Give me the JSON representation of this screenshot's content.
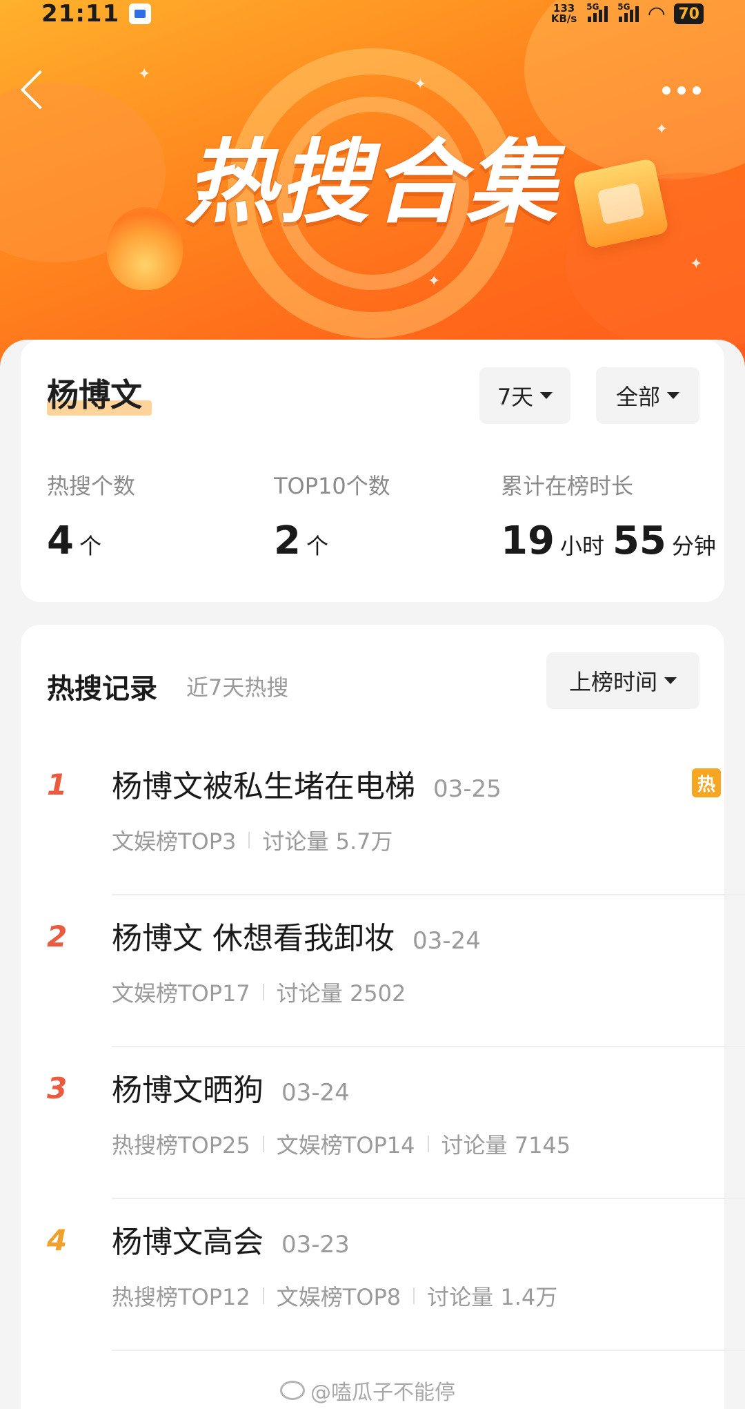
{
  "status_bar": {
    "time": "21:11",
    "speed_value": "133",
    "speed_unit": "KB/s",
    "sim1": "5G",
    "sim2": "5G",
    "battery": "70"
  },
  "header": {
    "title": "热搜合集",
    "back_icon": "chevron-left-icon",
    "more_icon": "more-dots-icon"
  },
  "profile": {
    "name": "杨博文",
    "filter_days": "7天",
    "filter_scope": "全部",
    "stats": [
      {
        "label": "热搜个数",
        "value": "4",
        "unit": "个"
      },
      {
        "label": "TOP10个数",
        "value": "2",
        "unit": "个"
      },
      {
        "label": "累计在榜时长",
        "hours": "19",
        "hours_unit": "小时",
        "minutes": "55",
        "minutes_unit": "分钟"
      }
    ]
  },
  "records": {
    "title": "热搜记录",
    "subtitle": "近7天热搜",
    "sort_label": "上榜时间",
    "hot_badge": "热",
    "items": [
      {
        "rank": "1",
        "title": "杨博文被私生堵在电梯",
        "date": "03-25",
        "meta": [
          "文娱榜TOP3",
          "讨论量 5.7万"
        ],
        "hot": true
      },
      {
        "rank": "2",
        "title": "杨博文 休想看我卸妆",
        "date": "03-24",
        "meta": [
          "文娱榜TOP17",
          "讨论量 2502"
        ],
        "hot": false
      },
      {
        "rank": "3",
        "title": "杨博文晒狗",
        "date": "03-24",
        "meta": [
          "热搜榜TOP25",
          "文娱榜TOP14",
          "讨论量 7145"
        ],
        "hot": false
      },
      {
        "rank": "4",
        "title": "杨博文高会",
        "date": "03-23",
        "meta": [
          "热搜榜TOP12",
          "文娱榜TOP8",
          "讨论量 1.4万"
        ],
        "hot": false
      }
    ]
  },
  "watermark": "@嗑瓜子不能停",
  "colors": {
    "banner_orange": "#ff7a1f",
    "rank_red": "#ea5b3f",
    "rank_orange": "#f0a02c",
    "hot_badge": "#f7a623"
  }
}
